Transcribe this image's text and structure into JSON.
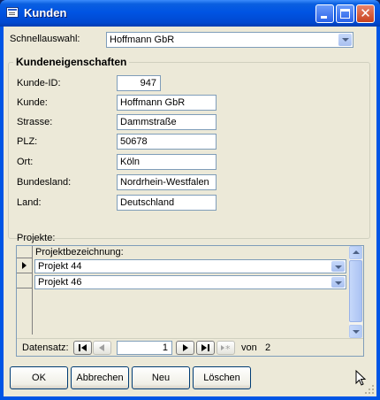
{
  "window": {
    "title": "Kunden",
    "icon": "form-icon"
  },
  "quick_select": {
    "label": "Schnellauswahl:",
    "value": "Hoffmann GbR"
  },
  "properties": {
    "title": "Kundeneigenschaften",
    "fields": [
      {
        "label": "Kunde-ID:",
        "value": "947"
      },
      {
        "label": "Kunde:",
        "value": "Hoffmann GbR"
      },
      {
        "label": "Strasse:",
        "value": "Dammstraße"
      },
      {
        "label": "PLZ:",
        "value": "50678"
      },
      {
        "label": "Ort:",
        "value": "Köln"
      },
      {
        "label": "Bundesland:",
        "value": "Nordrhein-Westfalen"
      },
      {
        "label": "Land:",
        "value": "Deutschland"
      }
    ]
  },
  "projects": {
    "label": "Projekte:",
    "column_header": "Projektbezeichnung:",
    "rows": [
      "Projekt 44",
      "Projekt 46"
    ]
  },
  "record_nav": {
    "label": "Datensatz:",
    "current": "1",
    "total_prefix": "von",
    "total": "2"
  },
  "buttons": {
    "ok": "OK",
    "cancel": "Abbrechen",
    "new": "Neu",
    "delete": "Löschen"
  },
  "colors": {
    "titlebar": "#0054e3",
    "client": "#ece9d8",
    "field_border": "#7f9db9"
  }
}
